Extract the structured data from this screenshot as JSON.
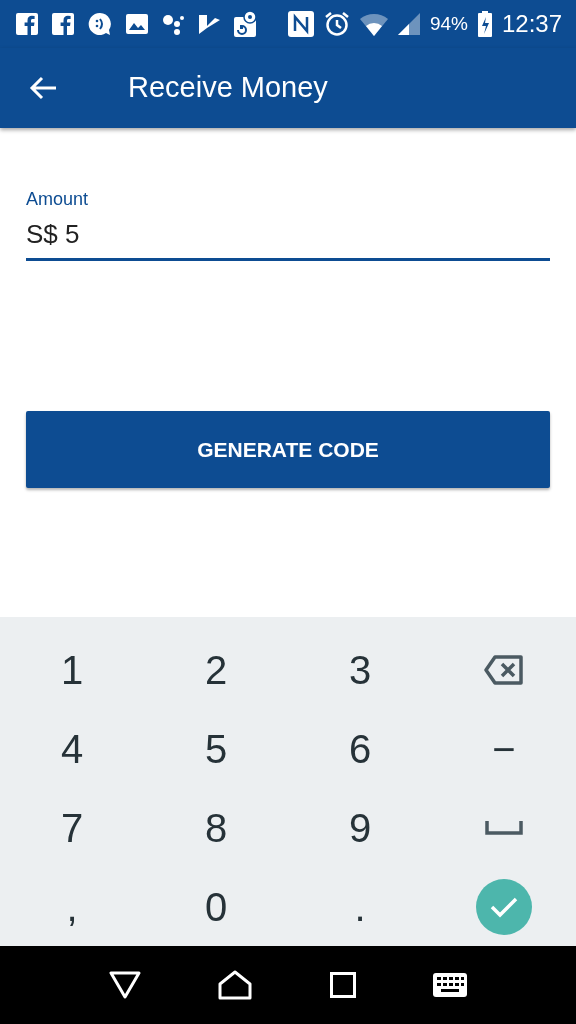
{
  "status_bar": {
    "battery": "94%",
    "time": "12:37"
  },
  "app_bar": {
    "title": "Receive Money"
  },
  "amount_field": {
    "label": "Amount",
    "value": "S$ 5"
  },
  "generate_button": {
    "label": "GENERATE CODE"
  },
  "keyboard": {
    "keys": [
      {
        "kind": "char",
        "label": "1"
      },
      {
        "kind": "char",
        "label": "2"
      },
      {
        "kind": "char",
        "label": "3"
      },
      {
        "kind": "backspace"
      },
      {
        "kind": "char",
        "label": "4"
      },
      {
        "kind": "char",
        "label": "5"
      },
      {
        "kind": "char",
        "label": "6"
      },
      {
        "kind": "char",
        "label": "−"
      },
      {
        "kind": "char",
        "label": "7"
      },
      {
        "kind": "char",
        "label": "8"
      },
      {
        "kind": "char",
        "label": "9"
      },
      {
        "kind": "space"
      },
      {
        "kind": "char",
        "label": ","
      },
      {
        "kind": "char",
        "label": "0"
      },
      {
        "kind": "char",
        "label": "."
      },
      {
        "kind": "done"
      }
    ]
  }
}
